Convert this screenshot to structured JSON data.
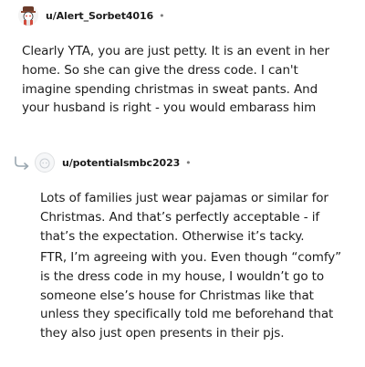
{
  "comment1": {
    "username": "u/Alert_Sorbet4016",
    "separator": "•",
    "body_lines": [
      "Clearly YTA, you are just petty. It is an event in her",
      "home. So she can give the dress code. I can't",
      "imagine spending christmas in sweat pants. And",
      "your husband is right - you would embarass him"
    ]
  },
  "comment2": {
    "username": "u/potentialsmbc2023",
    "separator": "•",
    "paragraph1_lines": [
      "Lots of families just wear pajamas or similar for",
      "Christmas. And that’s perfectly acceptable - if",
      "that’s the expectation. Otherwise it’s tacky."
    ],
    "paragraph2_lines": [
      "FTR, I’m agreeing with you. Even though “comfy”",
      "is the dress code in my house, I wouldn’t go to",
      "someone else’s house for Christmas like that",
      "unless they specifically told me beforehand that",
      "they also just open presents in their pjs."
    ]
  },
  "icons": {
    "avatar1": "snoo-avatar-icon",
    "avatar2": "default-avatar-icon",
    "reply": "reply-thread-arrow-icon"
  }
}
